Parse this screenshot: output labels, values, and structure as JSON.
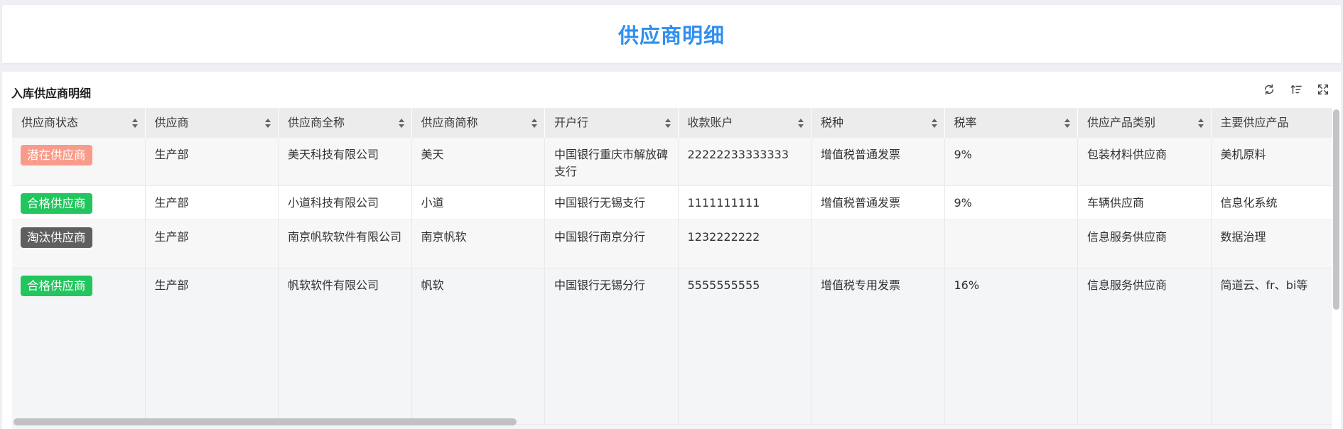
{
  "page": {
    "title": "供应商明细"
  },
  "panel": {
    "title": "入库供应商明细",
    "tools": [
      {
        "name": "refresh-icon"
      },
      {
        "name": "sort-icon"
      },
      {
        "name": "fullscreen-icon"
      }
    ]
  },
  "table": {
    "columns": [
      "供应商状态",
      "供应商",
      "供应商全称",
      "供应商简称",
      "开户行",
      "收款账户",
      "税种",
      "税率",
      "供应产品类别",
      "主要供应产品"
    ],
    "rows": [
      {
        "status": "潜在供应商",
        "status_color": "#f99b8a",
        "cells": [
          "生产部",
          "美天科技有限公司",
          "美天",
          "中国银行重庆市解放碑支行",
          "22222233333333",
          "增值税普通发票",
          "9%",
          "包装材料供应商",
          "美机原料"
        ]
      },
      {
        "status": "合格供应商",
        "status_color": "#22c55e",
        "cells": [
          "生产部",
          "小道科技有限公司",
          "小道",
          "中国银行无锡支行",
          "1111111111",
          "增值税普通发票",
          "9%",
          "车辆供应商",
          "信息化系统"
        ]
      },
      {
        "status": "淘汰供应商",
        "status_color": "#5f5f5f",
        "cells": [
          "生产部",
          "南京帆软软件有限公司",
          "南京帆软",
          "中国银行南京分行",
          "1232222222",
          "",
          "",
          "信息服务供应商",
          "数据治理"
        ]
      },
      {
        "status": "合格供应商",
        "status_color": "#22c55e",
        "cells": [
          "生产部",
          "帆软软件有限公司",
          "帆软",
          "中国银行无锡分行",
          "5555555555",
          "增值税专用发票",
          "16%",
          "信息服务供应商",
          "简道云、fr、bi等"
        ]
      }
    ]
  }
}
